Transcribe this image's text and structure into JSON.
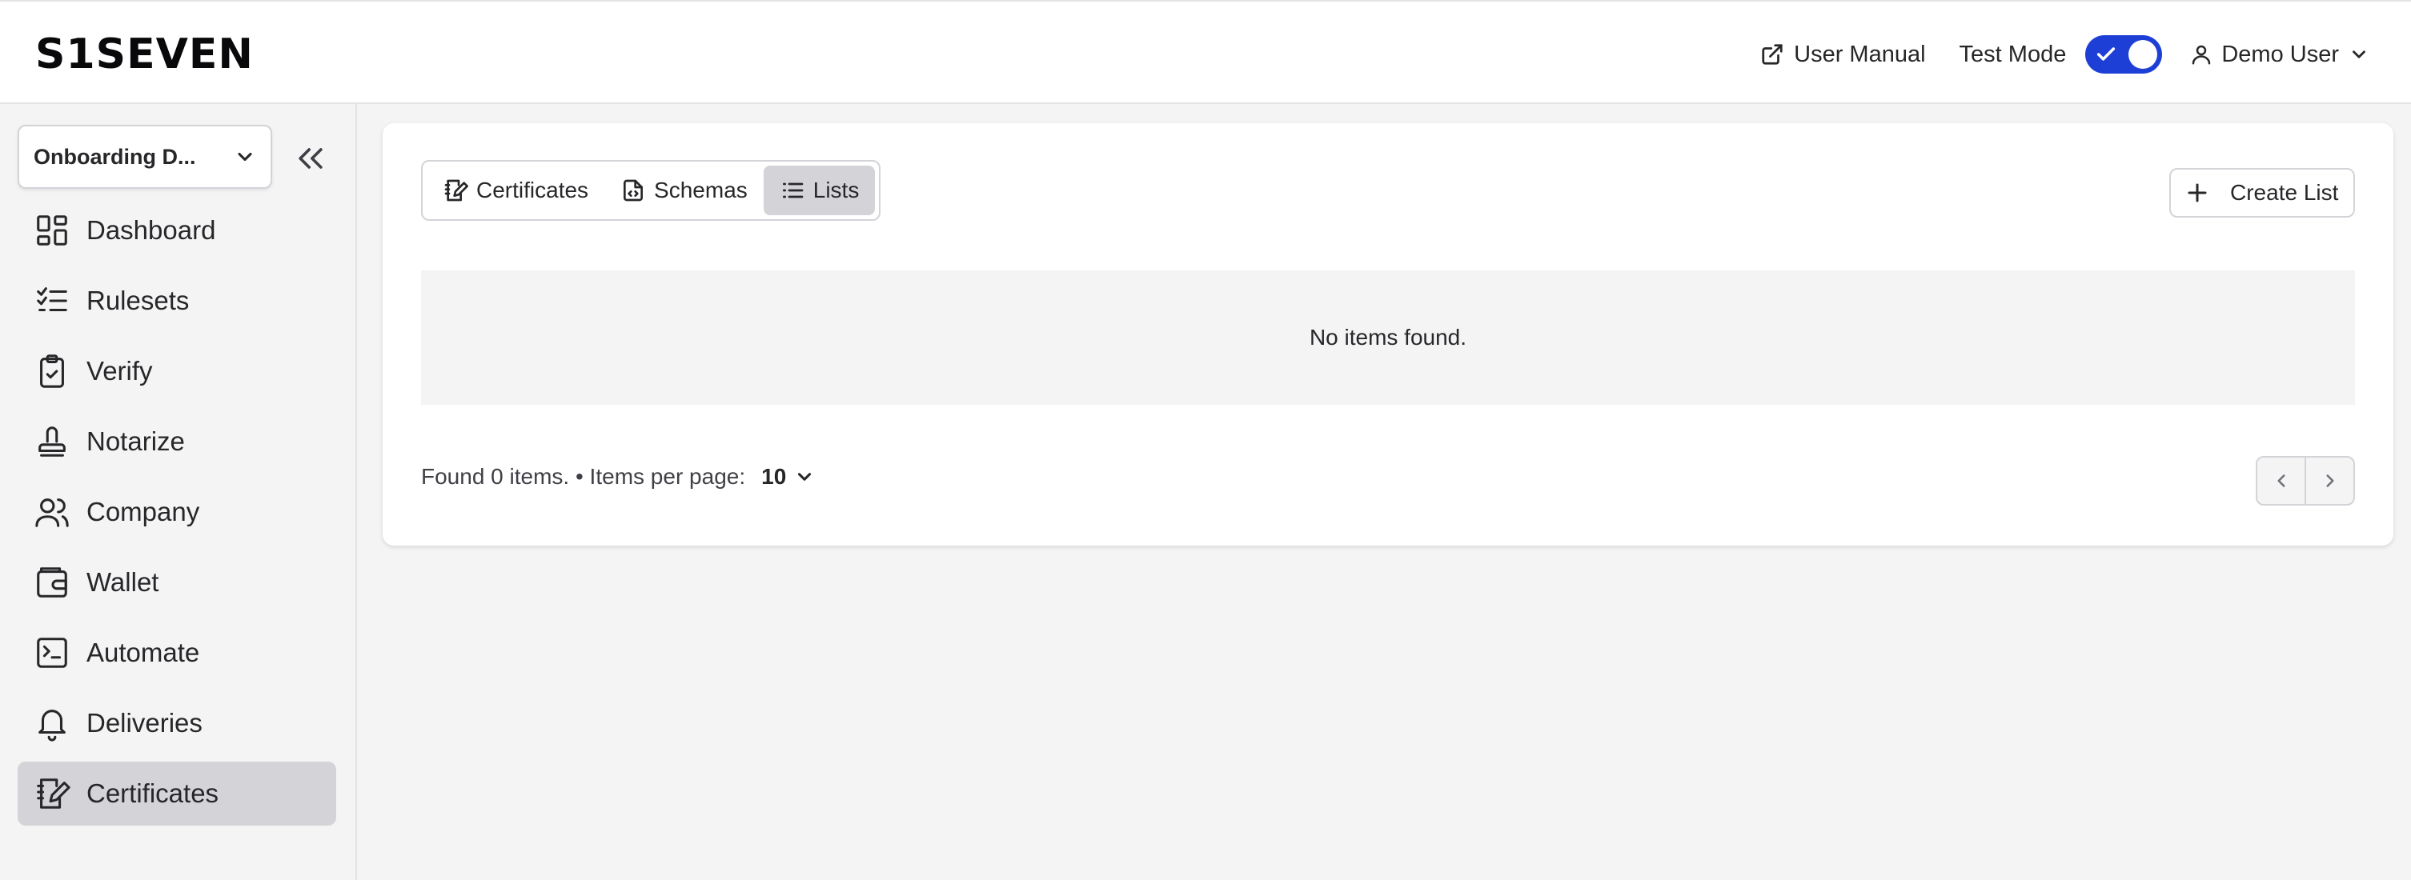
{
  "header": {
    "logo": "S1SEVEN",
    "user_manual_label": "User Manual",
    "test_mode_label": "Test Mode",
    "test_mode_on": true,
    "user_name": "Demo User",
    "accent_color": "#1d3fd6"
  },
  "sidebar": {
    "org_select": "Onboarding D...",
    "items": [
      {
        "label": "Dashboard",
        "icon": "dashboard-icon",
        "active": false
      },
      {
        "label": "Rulesets",
        "icon": "checklist-icon",
        "active": false
      },
      {
        "label": "Verify",
        "icon": "clipboard-check-icon",
        "active": false
      },
      {
        "label": "Notarize",
        "icon": "stamp-icon",
        "active": false
      },
      {
        "label": "Company",
        "icon": "users-icon",
        "active": false
      },
      {
        "label": "Wallet",
        "icon": "wallet-icon",
        "active": false
      },
      {
        "label": "Automate",
        "icon": "terminal-icon",
        "active": false
      },
      {
        "label": "Deliveries",
        "icon": "bell-icon",
        "active": false
      },
      {
        "label": "Certificates",
        "icon": "certificate-icon",
        "active": true
      }
    ]
  },
  "main": {
    "tabs": [
      {
        "label": "Certificates",
        "icon": "certificate-icon",
        "active": false
      },
      {
        "label": "Schemas",
        "icon": "document-code-icon",
        "active": false
      },
      {
        "label": "Lists",
        "icon": "list-icon",
        "active": true
      }
    ],
    "create_button": "Create List",
    "empty_message": "No items found.",
    "found_text": "Found 0 items. • Items per page:",
    "per_page": "10"
  }
}
